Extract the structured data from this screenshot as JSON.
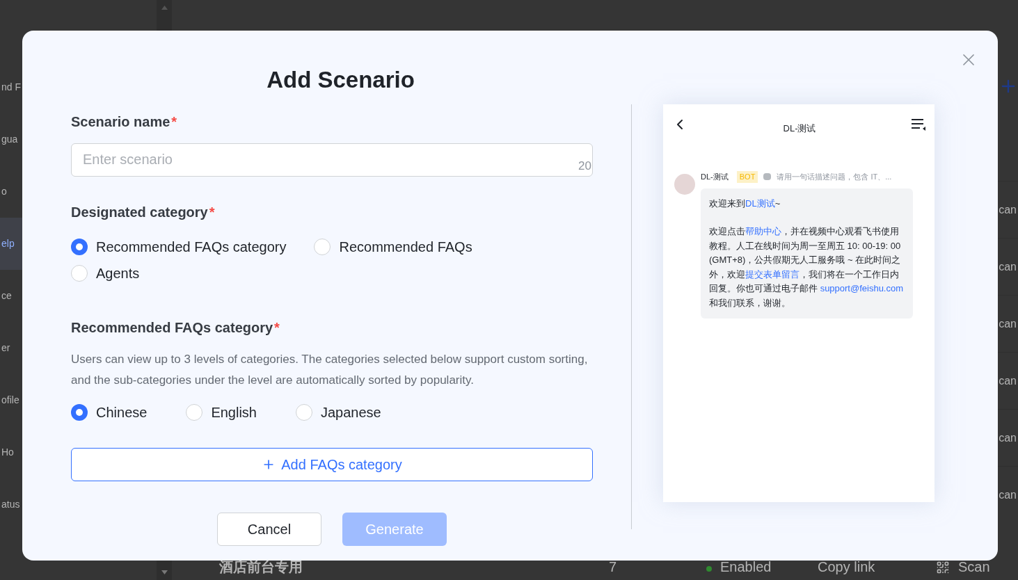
{
  "background": {
    "sidebar_items": [
      {
        "label": "nd F",
        "selected": false
      },
      {
        "label": "gua",
        "selected": false
      },
      {
        "label": "o",
        "selected": false
      },
      {
        "label": "elp",
        "selected": true
      },
      {
        "label": "ce",
        "selected": false
      },
      {
        "label": "er",
        "selected": false
      },
      {
        "label": "ofile",
        "selected": false
      },
      {
        "label": "Ho",
        "selected": false
      },
      {
        "label": "atus",
        "selected": false
      }
    ],
    "row_actions": [
      "can",
      "can",
      "can",
      "can",
      "can",
      "can"
    ],
    "last_row": {
      "name": "酒店前台专用",
      "count": "7",
      "status": "Enabled",
      "link": "Copy link",
      "action": "Scan"
    }
  },
  "dialog": {
    "title": "Add Scenario",
    "scenario_name": {
      "label": "Scenario name",
      "required_mark": "*",
      "placeholder": "Enter scenario",
      "counter": "20"
    },
    "designated_category": {
      "label": "Designated category",
      "required_mark": "*",
      "options": [
        {
          "label": "Recommended FAQs category",
          "selected": true
        },
        {
          "label": "Recommended FAQs",
          "selected": false
        },
        {
          "label": "Agents",
          "selected": false
        }
      ]
    },
    "faq_category": {
      "label": "Recommended FAQs category",
      "required_mark": "*",
      "description": "Users can view up to 3 levels of categories. The categories selected below support custom sorting, and the sub-categories under the level are automatically sorted by popularity.",
      "languages": [
        {
          "label": "Chinese",
          "selected": true
        },
        {
          "label": "English",
          "selected": false
        },
        {
          "label": "Japanese",
          "selected": false
        }
      ],
      "add_button": "Add FAQs category"
    },
    "buttons": [
      {
        "label": "Cancel",
        "kind": "secondary",
        "disabled": false
      },
      {
        "label": "Generate",
        "kind": "primary",
        "disabled": true
      }
    ],
    "preview": {
      "title": "DL-测试",
      "bot_name": "DL-测试",
      "badge": "BOT",
      "summary": "请用一句话描述问题，包含 IT、...",
      "message": [
        [
          {
            "text": "欢迎来到",
            "link": false
          },
          {
            "text": "DL测试",
            "link": true
          },
          {
            "text": "~",
            "link": false
          }
        ],
        [
          {
            "text": "欢迎点击",
            "link": false
          },
          {
            "text": "帮助中心",
            "link": true
          },
          {
            "text": "，并在视频中心观看飞书使用教程。人工在线时间为周一至周五 10: 00-19: 00 (GMT+8)，公共假期无人工服务哦 ~ 在此时间之外，欢迎",
            "link": false
          },
          {
            "text": "提交表单留言",
            "link": true
          },
          {
            "text": "，我们将在一个工作日内回复。你也可通过电子邮件 ",
            "link": false
          },
          {
            "text": "support@feishu.com",
            "link": true
          },
          {
            "text": " 和我们联系，谢谢。",
            "link": false
          }
        ]
      ]
    }
  }
}
